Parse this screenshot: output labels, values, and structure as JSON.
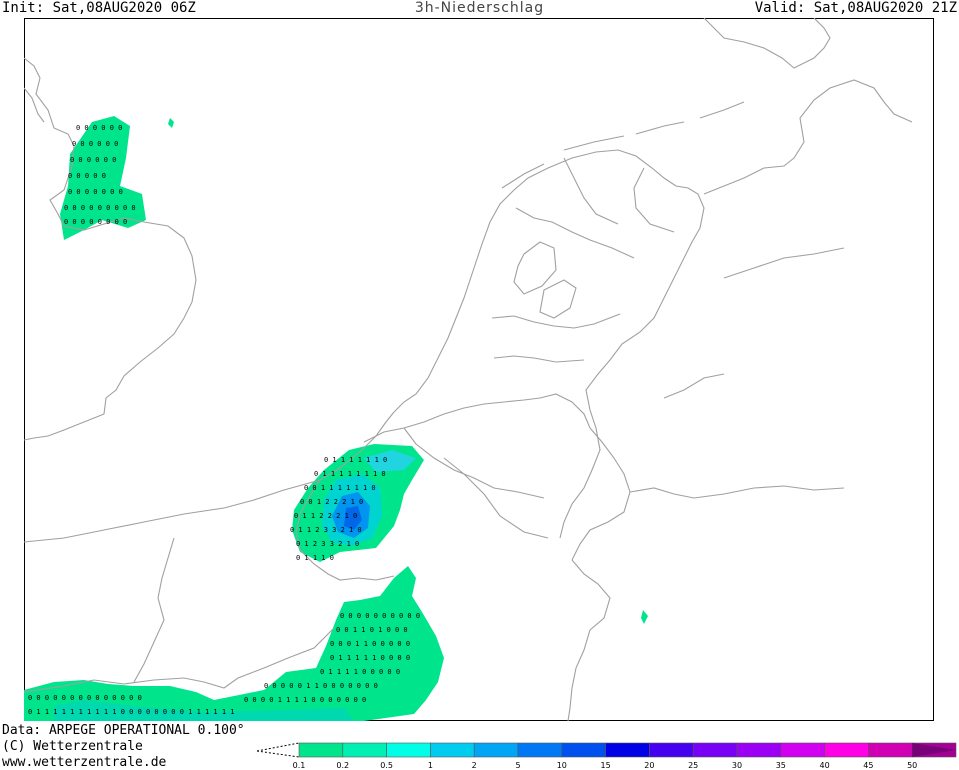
{
  "header": {
    "init": "Init: Sat,08AUG2020 06Z",
    "title": "3h-Niederschlag",
    "valid": "Valid: Sat,08AUG2020 21Z"
  },
  "footer": {
    "data_source": "Data: ARPEGE OPERATIONAL 0.100°",
    "copyright": "(C) Wetterzentrale",
    "website": "www.wetterzentrale.de"
  },
  "legend": {
    "levels": [
      {
        "label": "0.1",
        "color": "#00e58c"
      },
      {
        "label": "0.2",
        "color": "#00f0b4"
      },
      {
        "label": "0.5",
        "color": "#00ffe6"
      },
      {
        "label": "1",
        "color": "#00ccf0"
      },
      {
        "label": "2",
        "color": "#00a5f5"
      },
      {
        "label": "5",
        "color": "#0078f5"
      },
      {
        "label": "10",
        "color": "#0050f0"
      },
      {
        "label": "15",
        "color": "#0000e6"
      },
      {
        "label": "20",
        "color": "#4600f0"
      },
      {
        "label": "25",
        "color": "#7800f5"
      },
      {
        "label": "30",
        "color": "#9b00f5"
      },
      {
        "label": "35",
        "color": "#d200f0"
      },
      {
        "label": "40",
        "color": "#ff00e6"
      },
      {
        "label": "45",
        "color": "#d200b4"
      },
      {
        "label": "50",
        "color": "#a50096"
      }
    ],
    "overflow_color": "#780078"
  },
  "colors": {
    "border": "#a0a0a0",
    "frame": "#000000"
  }
}
